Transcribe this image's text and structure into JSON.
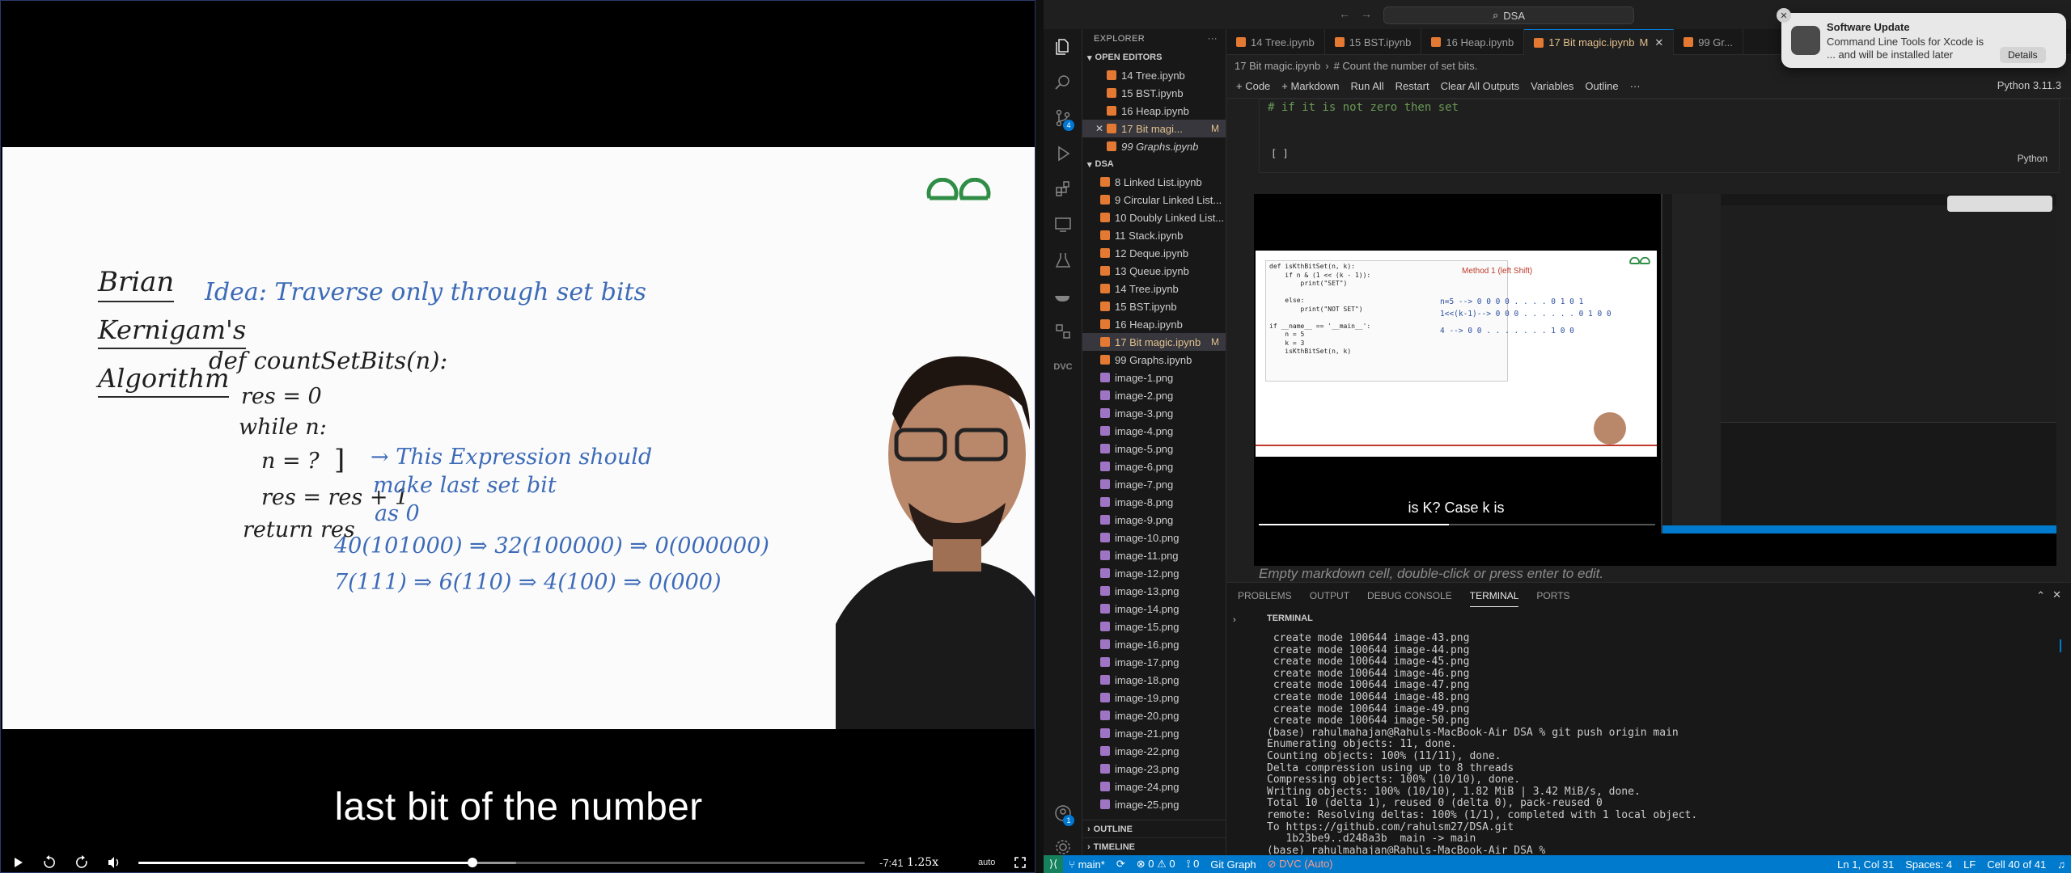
{
  "video": {
    "slide": {
      "title_lines": [
        "Brian",
        "Kernigam's",
        "Algorithm"
      ],
      "idea": "Idea: Traverse only through set bits",
      "code_lines": [
        "def countSetBits(n):",
        "res = 0",
        "while n:",
        "n = ?",
        "res = res + 1",
        "return res"
      ],
      "annotation_lines": [
        "→ This Expression should",
        "make last set bit",
        "as 0"
      ],
      "example_lines": [
        "40(101000) ⇒ 32(100000) ⇒ 0(000000)",
        "7(111) ⇒ 6(110) ⇒ 4(100) ⇒ 0(000)"
      ]
    },
    "subtitle": "last bit of the number",
    "controls": {
      "time_remaining": "-7:41",
      "speed": "1.25x",
      "quality": "auto",
      "progress": 0.46,
      "buffered": 0.52
    }
  },
  "vscode": {
    "command_center": "DSA",
    "explorer_title": "EXPLORER",
    "open_editors_title": "OPEN EDITORS",
    "open_editors": [
      {
        "name": "14 Tree.ipynb"
      },
      {
        "name": "15 BST.ipynb"
      },
      {
        "name": "16 Heap.ipynb"
      },
      {
        "name": "17 Bit magi...",
        "status": "M",
        "active": true
      },
      {
        "name": "99 Graphs.ipynb"
      }
    ],
    "folder_title": "DSA",
    "files": [
      {
        "name": "8 Linked List.ipynb"
      },
      {
        "name": "9 Circular Linked List..."
      },
      {
        "name": "10 Doubly Linked List..."
      },
      {
        "name": "11 Stack.ipynb"
      },
      {
        "name": "12 Deque.ipynb"
      },
      {
        "name": "13 Queue.ipynb"
      },
      {
        "name": "14 Tree.ipynb"
      },
      {
        "name": "15 BST.ipynb"
      },
      {
        "name": "16 Heap.ipynb"
      },
      {
        "name": "17 Bit magic.ipynb",
        "status": "M"
      },
      {
        "name": "99 Graphs.ipynb"
      },
      {
        "name": "image-1.png"
      },
      {
        "name": "image-2.png"
      },
      {
        "name": "image-3.png"
      },
      {
        "name": "image-4.png"
      },
      {
        "name": "image-5.png"
      },
      {
        "name": "image-6.png"
      },
      {
        "name": "image-7.png"
      },
      {
        "name": "image-8.png"
      },
      {
        "name": "image-9.png"
      },
      {
        "name": "image-10.png"
      },
      {
        "name": "image-11.png"
      },
      {
        "name": "image-12.png"
      },
      {
        "name": "image-13.png"
      },
      {
        "name": "image-14.png"
      },
      {
        "name": "image-15.png"
      },
      {
        "name": "image-16.png"
      },
      {
        "name": "image-17.png"
      },
      {
        "name": "image-18.png"
      },
      {
        "name": "image-19.png"
      },
      {
        "name": "image-20.png"
      },
      {
        "name": "image-21.png"
      },
      {
        "name": "image-22.png"
      },
      {
        "name": "image-23.png"
      },
      {
        "name": "image-24.png"
      },
      {
        "name": "image-25.png"
      }
    ],
    "outline_title": "OUTLINE",
    "timeline_title": "TIMELINE",
    "tabs": [
      {
        "name": "14 Tree.ipynb"
      },
      {
        "name": "15 BST.ipynb"
      },
      {
        "name": "16 Heap.ipynb"
      },
      {
        "name": "17 Bit magic.ipynb",
        "status": "M",
        "active": true
      },
      {
        "name": "99 Gr..."
      }
    ],
    "breadcrumb": [
      "17 Bit magic.ipynb",
      "# Count the number of set bits."
    ],
    "notebook_toolbar": [
      "+ Code",
      "+ Markdown",
      "Run All",
      "Restart",
      "Clear All Outputs",
      "Variables",
      "Outline",
      "···"
    ],
    "kernel": "Python 3.11.3",
    "cell1": {
      "code": "# if it is not zero then set",
      "exec": "[ ]",
      "lang": "Python"
    },
    "embedded": {
      "code_lines": [
        "def isKthBitSet(n, k):",
        "    if n & (1 << (k - 1)):",
        "        print(\"SET\")",
        "",
        "    else:",
        "        print(\"NOT SET\")",
        "",
        "if __name__ == '__main__':",
        "    n = 5",
        "    k = 3",
        "    isKthBitSet(n, k)",
        ""
      ],
      "method": "Method 1 (left Shift)",
      "lines": [
        "n=5    --> 0 0 0 0 . . . . 0 1 0 1",
        "1<<(k-1)--> 0 0 0 . . . . . . 0 1 0 0",
        "4         --> 0 0 . . . . . . . 1 0 0"
      ],
      "subtitle": "is K? Case k is"
    },
    "empty_markdown": "Empty markdown cell, double-click or press enter to edit.",
    "panel_tabs": [
      "PROBLEMS",
      "OUTPUT",
      "DEBUG CONSOLE",
      "TERMINAL",
      "PORTS"
    ],
    "active_panel_tab": "TERMINAL",
    "terminal_title": "TERMINAL",
    "terminal_lines": [
      " create mode 100644 image-43.png",
      " create mode 100644 image-44.png",
      " create mode 100644 image-45.png",
      " create mode 100644 image-46.png",
      " create mode 100644 image-47.png",
      " create mode 100644 image-48.png",
      " create mode 100644 image-49.png",
      " create mode 100644 image-50.png",
      "(base) rahulmahajan@Rahuls-MacBook-Air DSA % git push origin main",
      "Enumerating objects: 11, done.",
      "Counting objects: 100% (11/11), done.",
      "Delta compression using up to 8 threads",
      "Compressing objects: 100% (10/10), done.",
      "Writing objects: 100% (10/10), 1.82 MiB | 3.42 MiB/s, done.",
      "Total 10 (delta 1), reused 0 (delta 0), pack-reused 0",
      "remote: Resolving deltas: 100% (1/1), completed with 1 local object.",
      "To https://github.com/rahulsm27/DSA.git",
      "   1b23be9..d248a3b  main -> main",
      "(base) rahulmahajan@Rahuls-MacBook-Air DSA % "
    ],
    "status": {
      "branch": "main*",
      "errors": "0",
      "warnings": "0",
      "ports": "0",
      "git_graph": "Git Graph",
      "dvc": "DVC (Auto)",
      "position": "Ln 1, Col 31",
      "spaces": "Spaces: 4",
      "eol": "LF",
      "cell": "Cell 40 of 41"
    },
    "notification": {
      "title": "Software Update",
      "body": "Command Line Tools for Xcode is ... and will be installed later tonight.",
      "button": "Details"
    }
  }
}
